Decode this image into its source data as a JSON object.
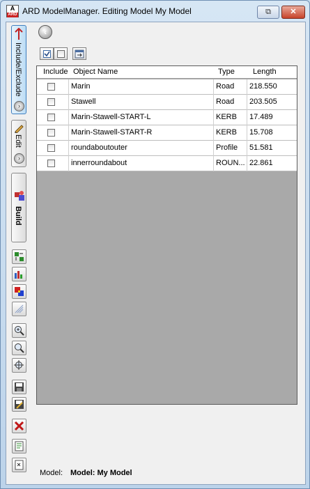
{
  "window": {
    "title": "ARD ModelManager. Editing Model  My Model",
    "app_icon_letter": "A",
    "app_icon_sub": "ARD"
  },
  "left_tabs": {
    "include_exclude": "Include/Exclude",
    "edit": "Edit",
    "build": "Build"
  },
  "grid": {
    "columns": [
      "Include",
      "Object Name",
      "Type",
      "Length"
    ],
    "rows": [
      {
        "include": false,
        "name": "Marin",
        "type": "Road",
        "length": "218.550"
      },
      {
        "include": false,
        "name": "Stawell",
        "type": "Road",
        "length": "203.505"
      },
      {
        "include": false,
        "name": "Marin-Stawell-START-L",
        "type": "KERB",
        "length": "17.489"
      },
      {
        "include": false,
        "name": "Marin-Stawell-START-R",
        "type": "KERB",
        "length": "15.708"
      },
      {
        "include": false,
        "name": "roundaboutouter",
        "type": "Profile",
        "length": "51.581"
      },
      {
        "include": false,
        "name": "innerroundabout",
        "type": "ROUN...",
        "length": "22.861"
      }
    ]
  },
  "status": {
    "label": "Model:",
    "value": "Model: My Model"
  },
  "colors": {
    "grid_empty": "#a9a9a9",
    "active_tab": "#bcdcf4",
    "close_button": "#c7432a"
  },
  "icons": {
    "back": "back-arrow-icon",
    "select_all": "select-all-checkbox-icon",
    "deselect_all": "deselect-all-checkbox-icon",
    "properties": "properties-icon"
  }
}
